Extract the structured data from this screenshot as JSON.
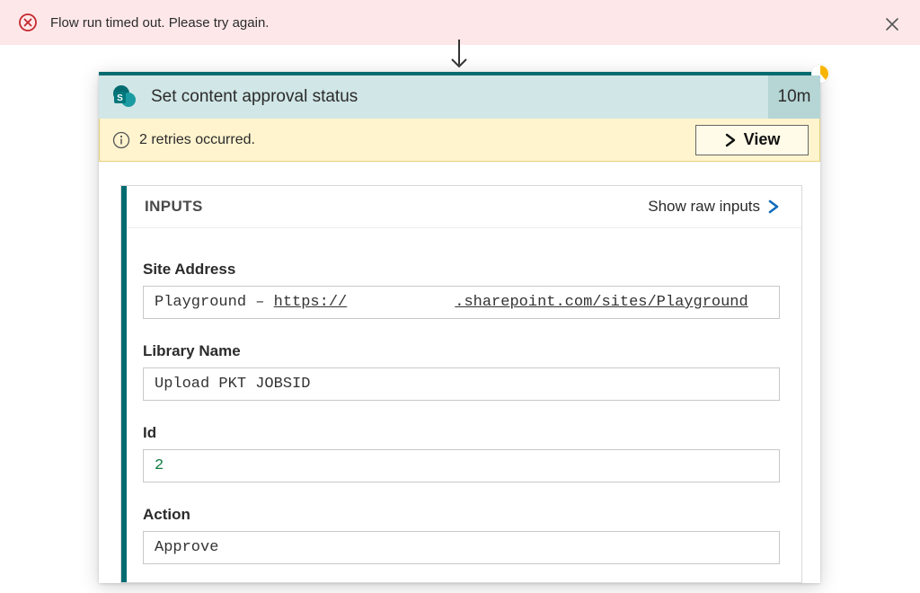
{
  "banner": {
    "message": "Flow run timed out. Please try again."
  },
  "card": {
    "icon": "sharepoint-icon",
    "title": "Set content approval status",
    "duration": "10m",
    "status": "timed-out"
  },
  "notice": {
    "text": "2 retries occurred.",
    "view_label": "View"
  },
  "inputs": {
    "section_label": "INPUTS",
    "raw_link_label": "Show raw inputs",
    "fields": {
      "site_address": {
        "label": "Site Address",
        "prefix": "Playground – ",
        "url_scheme": "https://",
        "url_host_redacted": "",
        "url_rest": ".sharepoint.com/sites/Playground"
      },
      "library_name": {
        "label": "Library Name",
        "value": "Upload PKT JOBSID"
      },
      "id": {
        "label": "Id",
        "value": "2"
      },
      "action": {
        "label": "Action",
        "value": "Approve"
      }
    }
  }
}
